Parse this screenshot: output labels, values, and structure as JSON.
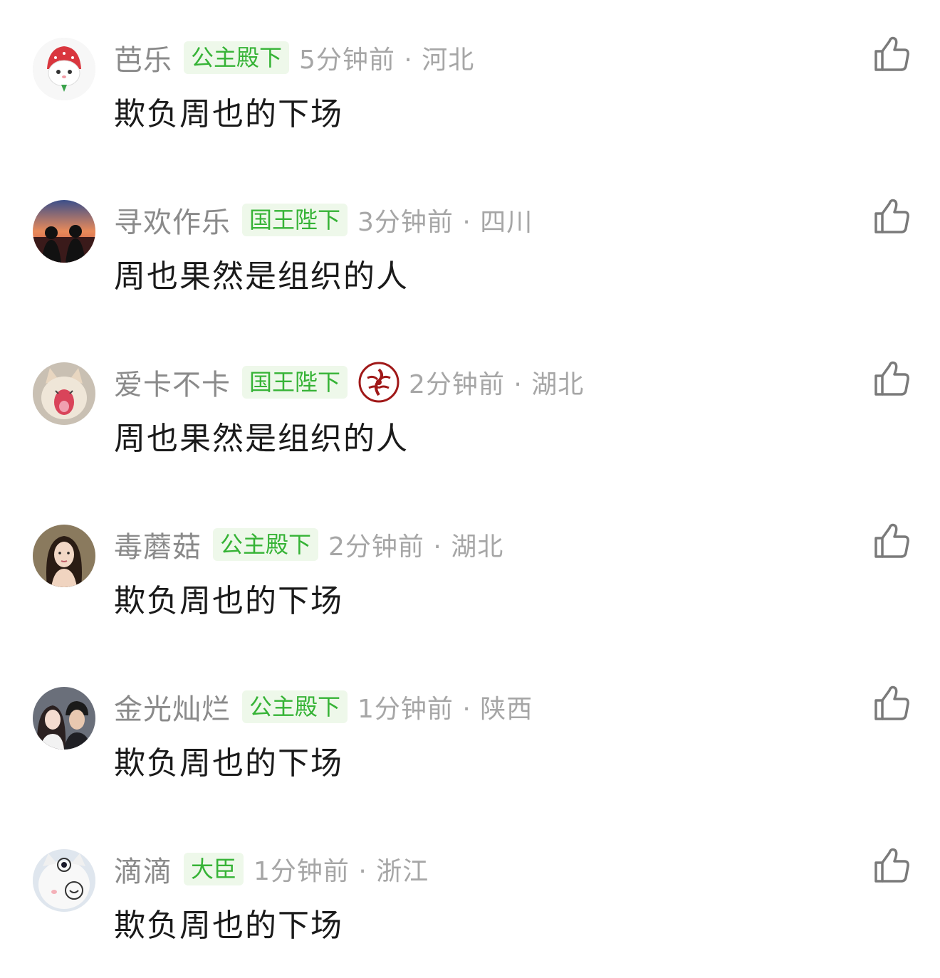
{
  "comments": [
    {
      "username": "芭乐",
      "badge": "公主殿下",
      "time_location": "5分钟前 · 河北",
      "text": "欺负周也的下场",
      "avatar_icon": "strawberry-cat-avatar"
    },
    {
      "username": "寻欢作乐",
      "badge": "国王陛下",
      "time_location": "3分钟前 · 四川",
      "text": "周也果然是组织的人",
      "avatar_icon": "sunset-couple-avatar"
    },
    {
      "username": "爱卡不卡",
      "badge": "国王陛下",
      "time_location": "2分钟前 · 湖北",
      "text": "周也果然是组织的人",
      "avatar_icon": "yawning-cat-avatar",
      "emblem_icon": "red-dragon-emblem"
    },
    {
      "username": "毒蘑菇",
      "badge": "公主殿下",
      "time_location": "2分钟前 · 湖北",
      "text": "欺负周也的下场",
      "avatar_icon": "woman-portrait-avatar"
    },
    {
      "username": "金光灿烂",
      "badge": "公主殿下",
      "time_location": "1分钟前 · 陕西",
      "text": "欺负周也的下场",
      "avatar_icon": "couple-photo-avatar"
    },
    {
      "username": "滴滴",
      "badge": "大臣",
      "time_location": "1分钟前 · 浙江",
      "text": "欺负周也的下场",
      "avatar_icon": "white-cat-glasses-avatar"
    }
  ],
  "like_icon": "thumbs-up-icon",
  "colors": {
    "username": "#8a8a8a",
    "badge_bg": "#eef8ea",
    "badge_text": "#36b336",
    "time": "#a6a6a6",
    "content": "#1a1a1a",
    "like_icon": "#7a7a7a"
  }
}
